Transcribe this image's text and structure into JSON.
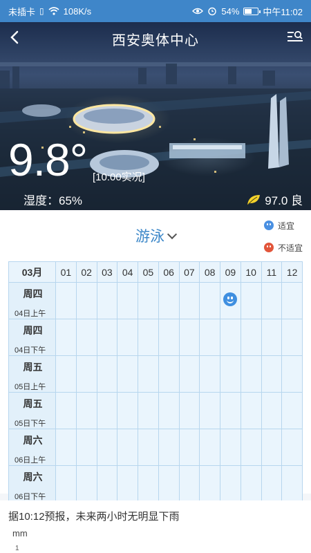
{
  "status_bar": {
    "carrier": "未插卡",
    "network_speed": "108K/s",
    "battery": "54%",
    "battery_level": 0.54,
    "time": "中午11:02"
  },
  "header": {
    "title": "西安奥体中心",
    "back_icon": "chevron-left-icon",
    "search_icon": "list-search-icon"
  },
  "weather": {
    "temperature": "9.8°",
    "observation": "[10:00实况]",
    "humidity": "湿度：65%",
    "aqi": "97.0 良",
    "aqi_color": "#f5d22b"
  },
  "activity": {
    "title": "游泳",
    "legend": [
      {
        "label": "适宜",
        "icon": "smile-face-icon",
        "color": "#4a90e2"
      },
      {
        "label": "不适宜",
        "icon": "frown-face-icon",
        "color": "#e2553a"
      }
    ],
    "month": "03月",
    "hours": [
      "01",
      "02",
      "03",
      "04",
      "05",
      "06",
      "07",
      "08",
      "09",
      "10",
      "11",
      "12"
    ],
    "rows": [
      {
        "weekday": "周四",
        "period": "04日上午",
        "suitable_hour": "09"
      },
      {
        "weekday": "周四",
        "period": "04日下午",
        "suitable_hour": ""
      },
      {
        "weekday": "周五",
        "period": "05日上午",
        "suitable_hour": ""
      },
      {
        "weekday": "周五",
        "period": "05日下午",
        "suitable_hour": ""
      },
      {
        "weekday": "周六",
        "period": "06日上午",
        "suitable_hour": ""
      },
      {
        "weekday": "周六",
        "period": "06日下午",
        "suitable_hour": ""
      }
    ]
  },
  "rain": {
    "forecast_text": "据10:12预报，未来两小时无明显下雨",
    "unit": "mm",
    "first_tick": "1"
  }
}
